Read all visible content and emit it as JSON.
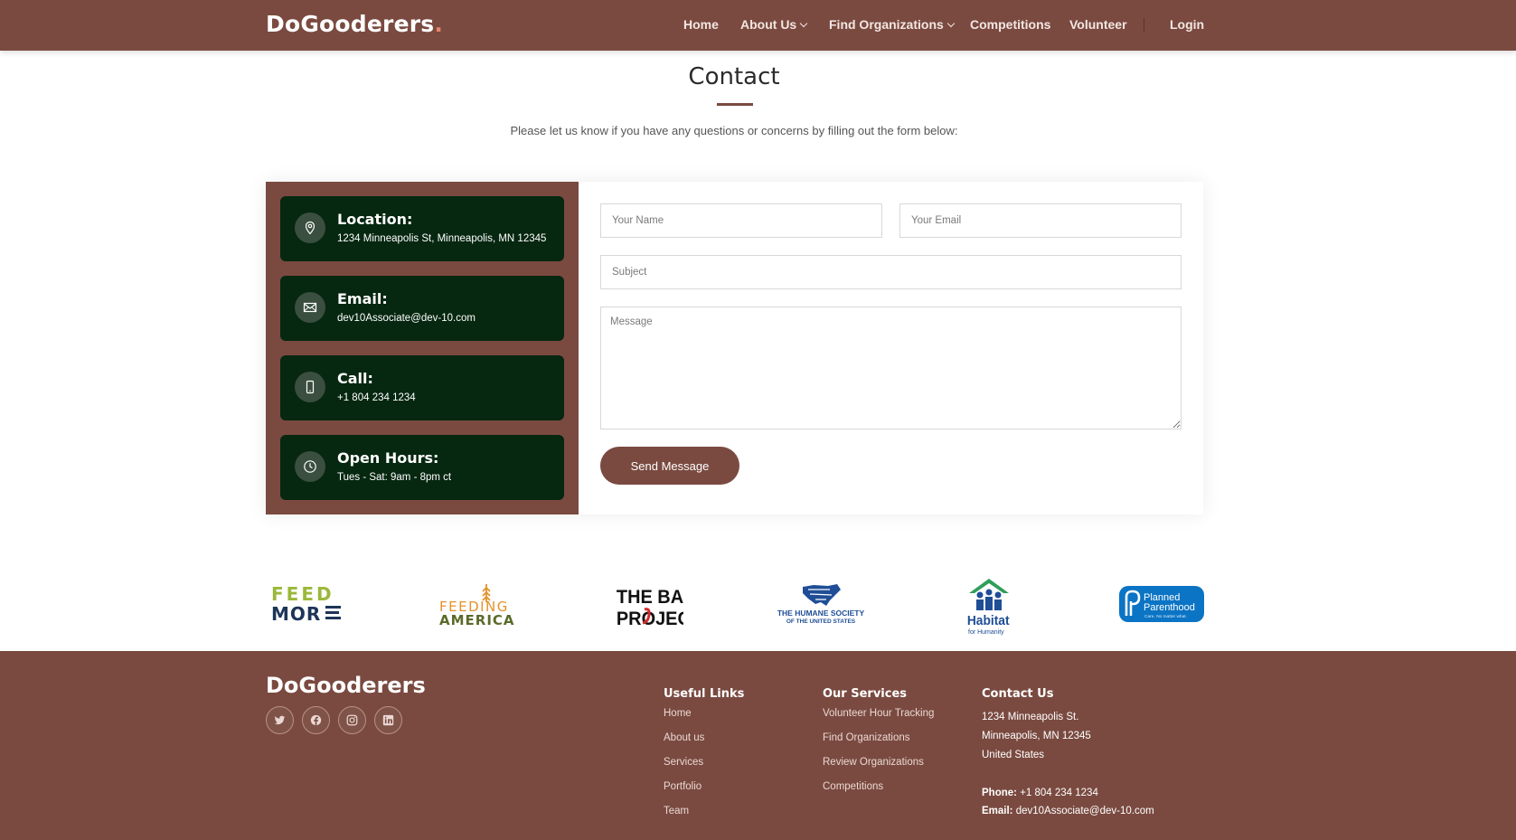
{
  "header": {
    "brand": "DoGooderers",
    "brand_dot": ".",
    "nav": {
      "home": "Home",
      "about": "About Us",
      "find": "Find Organizations",
      "competitions": "Competitions",
      "volunteer": "Volunteer",
      "login": "Login"
    }
  },
  "page": {
    "title": "Contact",
    "subtitle": "Please let us know if you have any questions or concerns by filling out the form below:"
  },
  "contact_info": {
    "location": {
      "label": "Location:",
      "value": "1234 Minneapolis St, Minneapolis, MN 12345",
      "icon": "map-pin-icon"
    },
    "email": {
      "label": "Email:",
      "value": "dev10Associate@dev-10.com",
      "icon": "envelope-icon"
    },
    "call": {
      "label": "Call:",
      "value": "+1 804 234 1234",
      "icon": "phone-icon"
    },
    "hours": {
      "label": "Open Hours:",
      "value": "Tues - Sat: 9am - 8pm ct",
      "icon": "clock-icon"
    }
  },
  "form": {
    "name_placeholder": "Your Name",
    "email_placeholder": "Your Email",
    "subject_placeholder": "Subject",
    "message_placeholder": "Message",
    "send_label": "Send Message"
  },
  "logos": {
    "feedmore": [
      "FEED",
      "MOR"
    ],
    "feeding_america": [
      "FEEDING",
      "AMERICA"
    ],
    "bail_project": [
      "THE BAIL",
      "PROJECT"
    ],
    "humane": [
      "THE HUMANE SOCIETY",
      "OF THE UNITED STATES"
    ],
    "habitat": [
      "Habitat",
      "for Humanity"
    ],
    "planned_parenthood": [
      "Planned",
      "Parenthood",
      "Care. No matter what."
    ]
  },
  "footer": {
    "brand": "DoGooderers",
    "useful_links": {
      "heading": "Useful Links",
      "items": [
        "Home",
        "About us",
        "Services",
        "Portfolio",
        "Team"
      ]
    },
    "our_services": {
      "heading": "Our Services",
      "items": [
        "Volunteer Hour Tracking",
        "Find Organizations",
        "Review Organizations",
        "Competitions"
      ]
    },
    "contact_us": {
      "heading": "Contact Us",
      "address_line1": "1234 Minneapolis St.",
      "address_line2": "Minneapolis, MN 12345",
      "address_line3": "United States",
      "phone_label": "Phone:",
      "phone_value": "+1 804 234 1234",
      "email_label": "Email:",
      "email_value": "dev10Associate@dev-10.com"
    }
  },
  "colors": {
    "brand_brown": "#7a4a40",
    "card_green": "#062710",
    "brand_dot": "#e8836a"
  }
}
